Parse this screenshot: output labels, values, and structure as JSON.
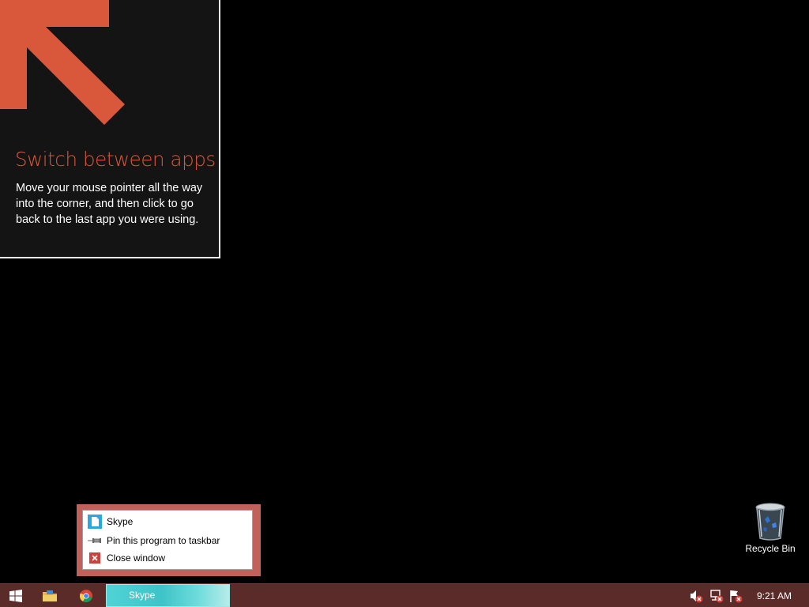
{
  "tutorial": {
    "title": "Switch between apps",
    "body": "Move your mouse pointer all the way into the corner, and then click to go back to the last app you were using.",
    "accent_color": "#d9573a"
  },
  "desktop": {
    "recycle_bin_label": "Recycle Bin"
  },
  "jump_list": {
    "app_label": "Skype",
    "pin_label": "Pin this program to taskbar",
    "close_label": "Close window",
    "frame_color": "#c2605a"
  },
  "taskbar": {
    "color": "#5b2b2a",
    "active_task_label": "Skype",
    "clock": "9:21 AM",
    "icons": [
      "windows-logo-icon",
      "file-explorer-icon",
      "chrome-icon",
      "volume-muted-icon",
      "network-error-icon",
      "action-center-flag-icon"
    ]
  }
}
